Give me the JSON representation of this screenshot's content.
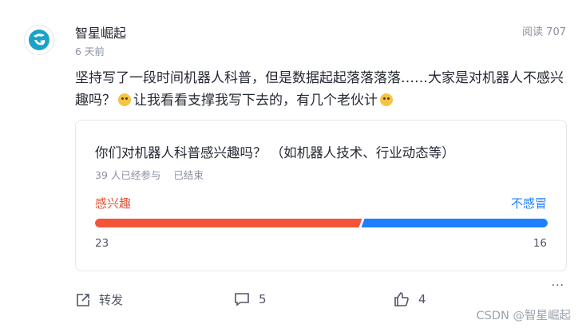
{
  "post": {
    "author": "智星崛起",
    "time": "6 天前",
    "views": "阅读 707",
    "content_a": "坚持写了一段时间机器人科普，但是数据起起落落落落……大家是对机器人不感兴趣吗？",
    "content_b": "让我看看支撑我写下去的，有几个老伙计"
  },
  "poll": {
    "question": "你们对机器人科普感兴趣吗？ （如机器人技术、行业动态等）",
    "participants": "39 人已经参与",
    "status": "已结束",
    "option_left": {
      "label": "感兴趣",
      "count": "23",
      "color": "#f2553a"
    },
    "option_right": {
      "label": "不感冒",
      "count": "16",
      "color": "#1e80ff"
    },
    "share_left": 0.59
  },
  "actions": {
    "share_label": "转发",
    "comment_count": "5",
    "like_count": "4"
  },
  "more_label": "···",
  "watermark": "CSDN @智星崛起"
}
